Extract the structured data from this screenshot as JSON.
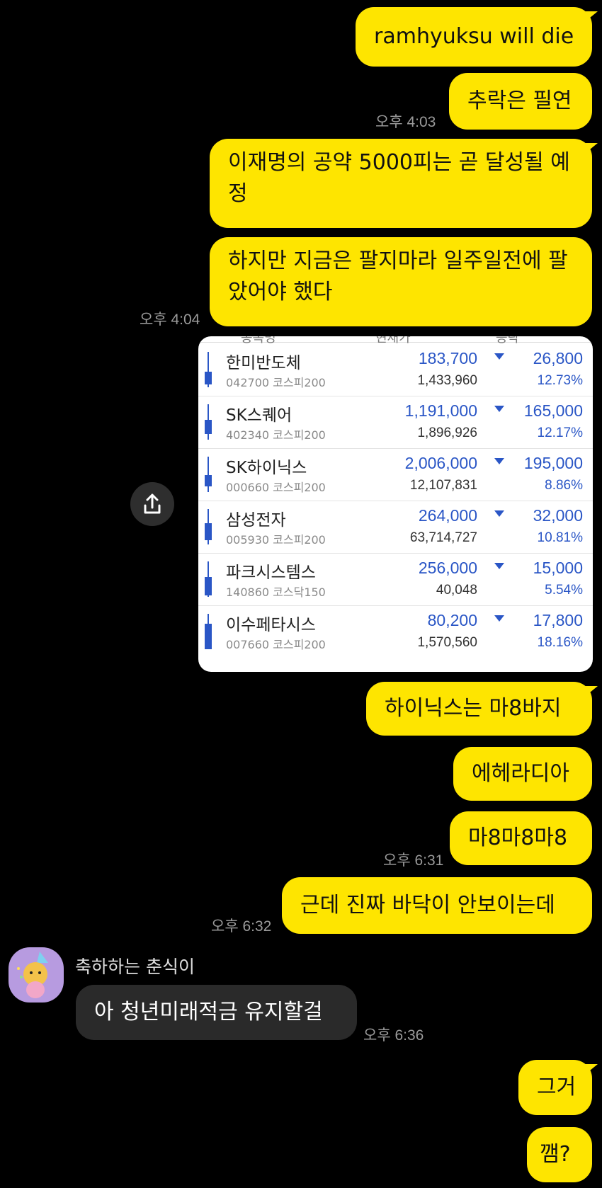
{
  "messages": [
    {
      "text": "ramhyuksu will die"
    },
    {
      "text": "추락은 필연",
      "time": "오후 4:03"
    },
    {
      "text": "이재명의 공약 5000피는 곧 달성될 예정"
    },
    {
      "text": "하지만 지금은 팔지마라 일주일전에 팔았어야 했다",
      "time": "오후 4:04"
    },
    {
      "text": "하이닉스는 마8바지"
    },
    {
      "text": "에헤라디아"
    },
    {
      "text": "마8마8마8",
      "time": "오후 6:31"
    },
    {
      "text": "근데 진짜 바닥이 안보이는데",
      "time": "오후 6:32"
    },
    {
      "text": "그거"
    },
    {
      "text": "깸?"
    }
  ],
  "incoming": {
    "sender": "축하하는 춘식이",
    "text": "아 청년미래적금 유지할걸",
    "time": "오후 6:36",
    "avatar_icon": "chunsik-party-avatar"
  },
  "stock_card": {
    "header": [
      "종목명",
      "현재가",
      "등락"
    ],
    "stocks": [
      {
        "name": "한미반도체",
        "code": "042700 코스피200",
        "price": "183,700",
        "volume": "1,433,960",
        "change": "26,800",
        "pct": "12.73%"
      },
      {
        "name": "SK스퀘어",
        "code": "402340 코스피200",
        "price": "1,191,000",
        "volume": "1,896,926",
        "change": "165,000",
        "pct": "12.17%"
      },
      {
        "name": "SK하이닉스",
        "code": "000660 코스피200",
        "price": "2,006,000",
        "volume": "12,107,831",
        "change": "195,000",
        "pct": "8.86%"
      },
      {
        "name": "삼성전자",
        "code": "005930 코스피200",
        "price": "264,000",
        "volume": "63,714,727",
        "change": "32,000",
        "pct": "10.81%"
      },
      {
        "name": "파크시스템스",
        "code": "140860 코스닥150",
        "price": "256,000",
        "volume": "40,048",
        "change": "15,000",
        "pct": "5.54%"
      },
      {
        "name": "이수페타시스",
        "code": "007660 코스피200",
        "price": "80,200",
        "volume": "1,570,560",
        "change": "17,800",
        "pct": "18.16%"
      }
    ],
    "down_color": "#2a56c6"
  },
  "share_icon": "share-upload-icon",
  "colors": {
    "my_bubble": "#FEE500",
    "other_bubble": "#2a2a2a",
    "background": "#000000"
  }
}
